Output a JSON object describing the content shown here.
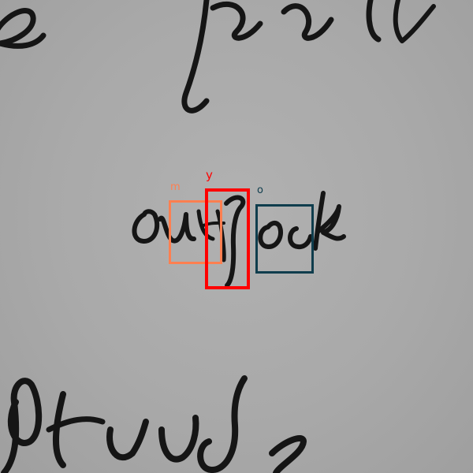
{
  "annotations": [
    {
      "label": "m",
      "color": "#ff7f50"
    },
    {
      "label": "y",
      "color": "#ff0000"
    },
    {
      "label": "o",
      "color": "#0f3d4d"
    }
  ]
}
